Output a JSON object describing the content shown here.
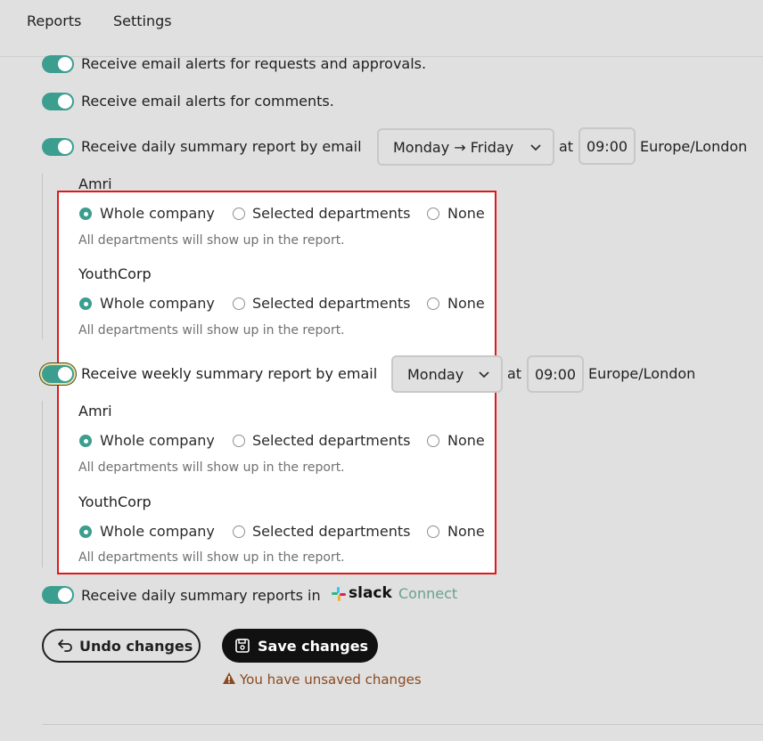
{
  "tabs": [
    "Reports",
    "Settings"
  ],
  "settings": {
    "email_requests": "Receive email alerts for requests and approvals.",
    "email_comments": "Receive email alerts for comments.",
    "daily_summary": {
      "label": "Receive daily summary report by email",
      "day_range": "Monday → Friday",
      "at": "at",
      "time": "09:00",
      "timezone": "Europe/London"
    },
    "weekly_summary": {
      "label": "Receive weekly summary report by email",
      "day": "Monday",
      "at": "at",
      "time": "09:00",
      "timezone": "Europe/London"
    },
    "slack": {
      "label": "Receive daily summary reports in",
      "brand": "slack",
      "connect": "Connect"
    }
  },
  "daily_companies": [
    {
      "name": "Amri",
      "options": [
        "Whole company",
        "Selected departments",
        "None"
      ],
      "selected": "Whole company",
      "hint": "All departments will show up in the report."
    },
    {
      "name": "YouthCorp",
      "options": [
        "Whole company",
        "Selected departments",
        "None"
      ],
      "selected": "Whole company",
      "hint": "All departments will show up in the report."
    }
  ],
  "weekly_companies": [
    {
      "name": "Amri",
      "options": [
        "Whole company",
        "Selected departments",
        "None"
      ],
      "selected": "Whole company",
      "hint": "All departments will show up in the report."
    },
    {
      "name": "YouthCorp",
      "options": [
        "Whole company",
        "Selected departments",
        "None"
      ],
      "selected": "Whole company",
      "hint": "All departments will show up in the report."
    }
  ],
  "actions": {
    "undo": "Undo changes",
    "save": "Save changes",
    "warning": "You have unsaved changes"
  },
  "colors": {
    "accent": "#3b9e8f",
    "highlight_border": "#e0181c",
    "warning": "#8a4a1f"
  }
}
